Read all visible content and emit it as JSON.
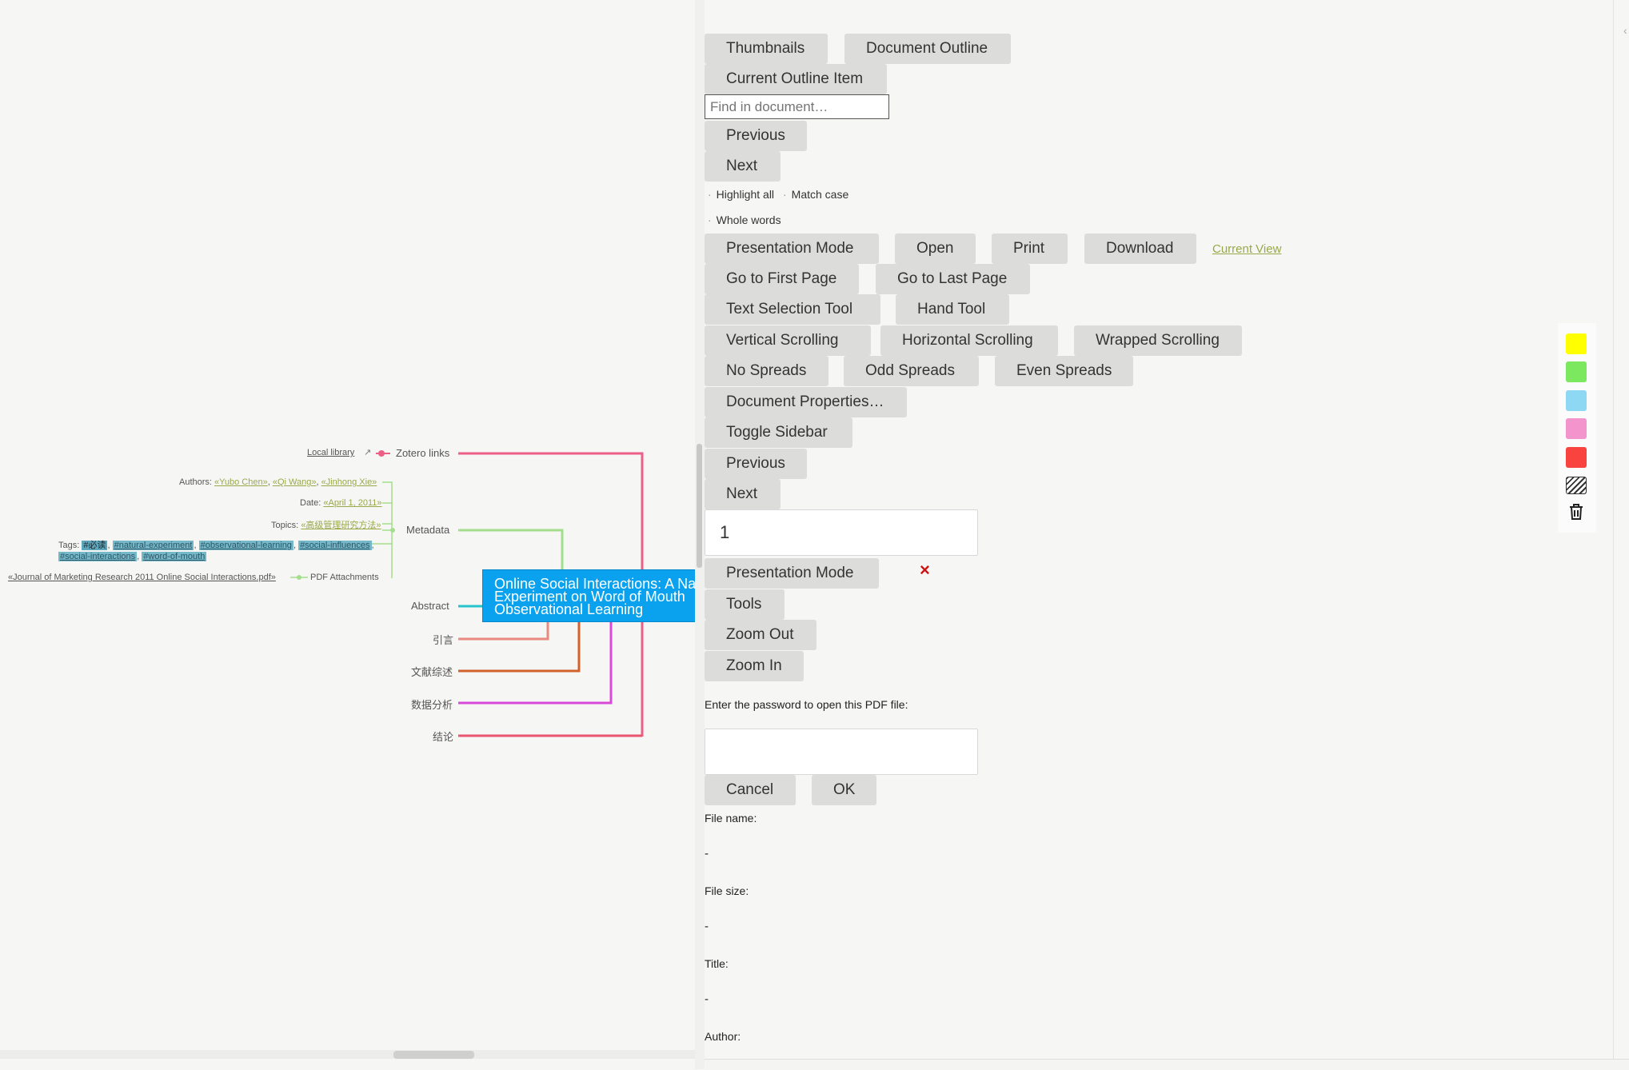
{
  "mindmap": {
    "central": {
      "line1": "Online Social Interactions: A Na",
      "line2": "Experiment on Word of Mouth",
      "line3": "Observational Learning"
    },
    "branches": {
      "zotero_links": "Zotero links",
      "metadata": "Metadata",
      "pdf_attachments": "PDF Attachments",
      "abstract": "Abstract",
      "intro": "引言",
      "literature": "文献综述",
      "analysis": "数据分析",
      "conclusion": "结论"
    },
    "local_library": "Local library",
    "authors_label": "Authors:",
    "authors": [
      "«Yubo Chen»",
      "«Qi Wang»",
      "«Jinhong Xie»"
    ],
    "date_label": "Date:",
    "date_value": "«April 1, 2011»",
    "topics_label": "Topics:",
    "topics_value": "«高级管理研究方法»",
    "tags_label": "Tags:",
    "tags": [
      "#必读",
      "#natural-experiment",
      "#observational-learning",
      "#social-influences",
      "#social-interactions",
      "#word-of-mouth"
    ],
    "pdf_file": "«Journal of Marketing Research 2011 Online Social Interactions.pdf»",
    "colors": {
      "zotero": "#ec5f86",
      "metadata": "#a4de8c",
      "pdf": "#a4de8c",
      "abstract": "#27c4cc",
      "intro": "#e88a7f",
      "literature": "#d2612c",
      "analysis": "#d84ad8",
      "conclusion": "#ea5570"
    }
  },
  "viewer": {
    "thumbnails": "Thumbnails",
    "document_outline": "Document Outline",
    "current_outline_item": "Current Outline Item",
    "find_placeholder": "Find in document…",
    "find_previous": "Previous",
    "find_next": "Next",
    "highlight_all": "Highlight all",
    "match_case": "Match case",
    "whole_words": "Whole words",
    "presentation_mode": "Presentation Mode",
    "open": "Open",
    "print": "Print",
    "download": "Download",
    "current_view": "Current View",
    "go_first_page": "Go to First Page",
    "go_last_page": "Go to Last Page",
    "text_selection_tool": "Text Selection Tool",
    "hand_tool": "Hand Tool",
    "vertical_scrolling": "Vertical Scrolling",
    "horizontal_scrolling": "Horizontal Scrolling",
    "wrapped_scrolling": "Wrapped Scrolling",
    "no_spreads": "No Spreads",
    "odd_spreads": "Odd Spreads",
    "even_spreads": "Even Spreads",
    "document_properties": "Document Properties…",
    "toggle_sidebar": "Toggle Sidebar",
    "page_previous": "Previous",
    "page_next": "Next",
    "page_number": "1",
    "presentation_mode_2": "Presentation Mode",
    "close_symbol": "×",
    "tools": "Tools",
    "zoom_out": "Zoom Out",
    "zoom_in": "Zoom In",
    "password_prompt": "Enter the password to open this PDF file:",
    "cancel": "Cancel",
    "ok": "OK",
    "file_name_label": "File name:",
    "file_name_value": "-",
    "file_size_label": "File size:",
    "file_size_value": "-",
    "title_label": "Title:",
    "title_value": "-",
    "author_label": "Author:"
  },
  "palette": {
    "colors": [
      "#ffff00",
      "#7be85f",
      "#8fd8f3",
      "#f494cc",
      "#f9433f"
    ]
  }
}
